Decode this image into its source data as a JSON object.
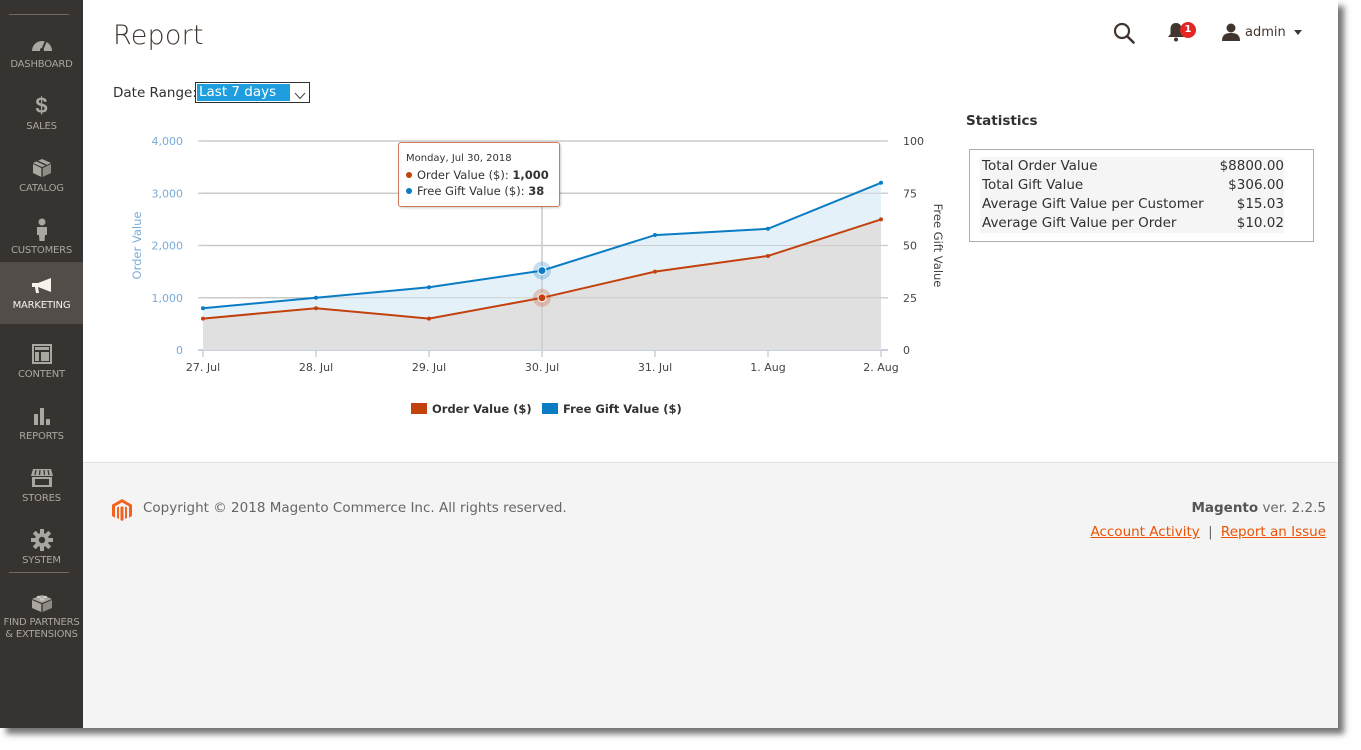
{
  "sidebar": {
    "items": [
      {
        "label": "DASHBOARD",
        "icon": "dashboard-gauge-icon"
      },
      {
        "label": "SALES",
        "icon": "dollar-icon"
      },
      {
        "label": "CATALOG",
        "icon": "box-icon"
      },
      {
        "label": "CUSTOMERS",
        "icon": "person-icon"
      },
      {
        "label": "MARKETING",
        "icon": "megaphone-icon",
        "active": true
      },
      {
        "label": "CONTENT",
        "icon": "layout-icon"
      },
      {
        "label": "REPORTS",
        "icon": "bar-chart-icon"
      },
      {
        "label": "STORES",
        "icon": "storefront-icon"
      },
      {
        "label": "SYSTEM",
        "icon": "gear-icon"
      },
      {
        "label": "FIND PARTNERS",
        "label2": "& EXTENSIONS",
        "icon": "lego-brick-icon"
      }
    ]
  },
  "header": {
    "title": "Report",
    "notifications_count": "1",
    "username": "admin"
  },
  "filter": {
    "label": "Date Range:",
    "selected": "Last 7 days"
  },
  "tooltip": {
    "date": "Monday, Jul 30, 2018",
    "rows": [
      {
        "label": "Order Value ($): ",
        "value": "1,000",
        "color": "#c2410c"
      },
      {
        "label": "Free Gift Value ($): ",
        "value": "38",
        "color": "#0a7cc4"
      }
    ]
  },
  "chart_data": {
    "type": "area",
    "title": "",
    "categories": [
      "27. Jul",
      "28. Jul",
      "29. Jul",
      "30. Jul",
      "31. Jul",
      "1. Aug",
      "2. Aug"
    ],
    "series": [
      {
        "name": "Order Value ($)",
        "axis": "left",
        "color": "#c2410c",
        "values": [
          600,
          800,
          600,
          1000,
          1500,
          1800,
          2500
        ]
      },
      {
        "name": "Free Gift Value ($)",
        "axis": "right",
        "color": "#0a7cc4",
        "values": [
          20,
          25,
          30,
          38,
          55,
          58,
          80
        ]
      }
    ],
    "ylabel": "Order Value",
    "ylabel_right": "Free Gift Value",
    "ylim": [
      0,
      4000
    ],
    "ylim_right": [
      0,
      100
    ],
    "yticks": [
      "0",
      "1,000",
      "2,000",
      "3,000",
      "4,000"
    ],
    "yticks_right": [
      "0",
      "25",
      "50",
      "75",
      "100"
    ],
    "grid": true,
    "legend": "bottom-center",
    "highlight_index": 3
  },
  "statistics": {
    "title": "Statistics",
    "rows": [
      {
        "label": "Total Order Value",
        "value": "$8800.00"
      },
      {
        "label": "Total Gift Value",
        "value": "$306.00"
      },
      {
        "label": "Average Gift Value per Customer",
        "value": "$15.03"
      },
      {
        "label": "Average Gift Value per Order",
        "value": "$10.02"
      }
    ]
  },
  "footer": {
    "copyright": "Copyright © 2018 Magento Commerce Inc. All rights reserved.",
    "brand": "Magento",
    "version": " ver. 2.2.5",
    "links": [
      "Account Activity",
      "Report an Issue"
    ],
    "separator": "|"
  }
}
